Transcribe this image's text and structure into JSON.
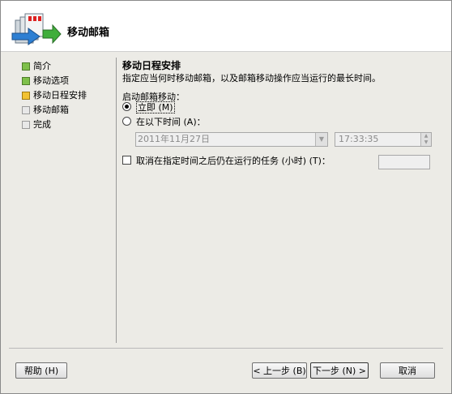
{
  "header": {
    "title": "移动邮箱",
    "icon": "mailbox-move-icon"
  },
  "steps": [
    {
      "label": "简介",
      "status": "done"
    },
    {
      "label": "移动选项",
      "status": "done"
    },
    {
      "label": "移动日程安排",
      "status": "current"
    },
    {
      "label": "移动邮箱",
      "status": "pending"
    },
    {
      "label": "完成",
      "status": "pending"
    }
  ],
  "content": {
    "title": "移动日程安排",
    "description": "指定应当何时移动邮箱，以及邮箱移动操作应当运行的最长时间。",
    "start_label": "启动邮箱移动：",
    "option_now": "立即 (M)",
    "option_at": "在以下时间 (A)：",
    "date_value": "2011年11月27日",
    "time_value": "17:33:35",
    "cancel_label": "取消在指定时间之后仍在运行的任务 (小时) (T)：",
    "cancel_hours_value": ""
  },
  "buttons": {
    "help": "帮助 (H)",
    "back": "< 上一步 (B)",
    "next": "下一步 (N) >",
    "cancel": "取消"
  }
}
